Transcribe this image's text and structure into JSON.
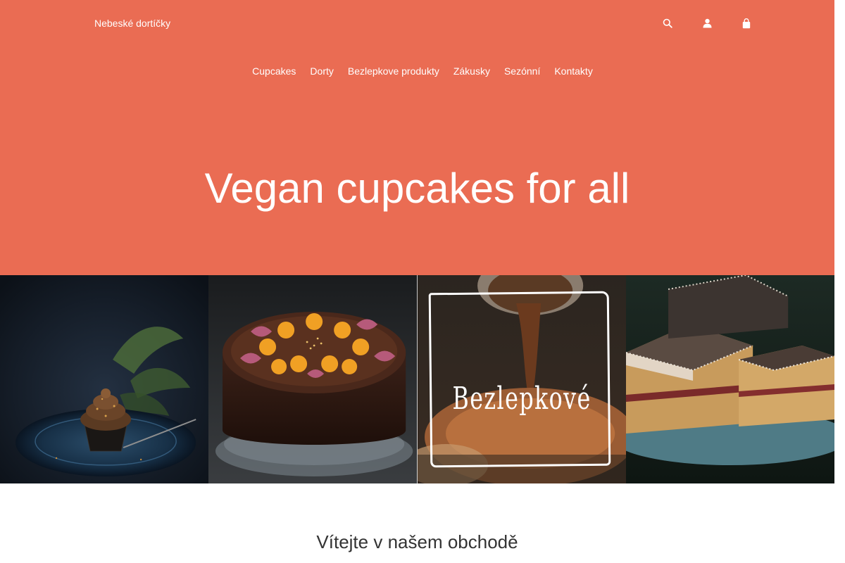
{
  "header": {
    "brand": "Nebeské dortíčky",
    "icons": [
      "search-icon",
      "user-icon",
      "cart-icon"
    ]
  },
  "nav": {
    "items": [
      {
        "label": "Cupcakes"
      },
      {
        "label": "Dorty"
      },
      {
        "label": "Bezlepkove produkty"
      },
      {
        "label": "Zákusky"
      },
      {
        "label": "Sezónní"
      },
      {
        "label": "Kontakty"
      }
    ]
  },
  "hero": {
    "title": "Vegan cupcakes for all",
    "background": "#ea6c53"
  },
  "tiles": [
    {
      "name": "cupcake"
    },
    {
      "name": "cake"
    },
    {
      "name": "gluten-free",
      "caption": "Bezlepkové"
    },
    {
      "name": "pastry"
    }
  ],
  "welcome": {
    "title": "Vítejte v našem obchodě"
  }
}
